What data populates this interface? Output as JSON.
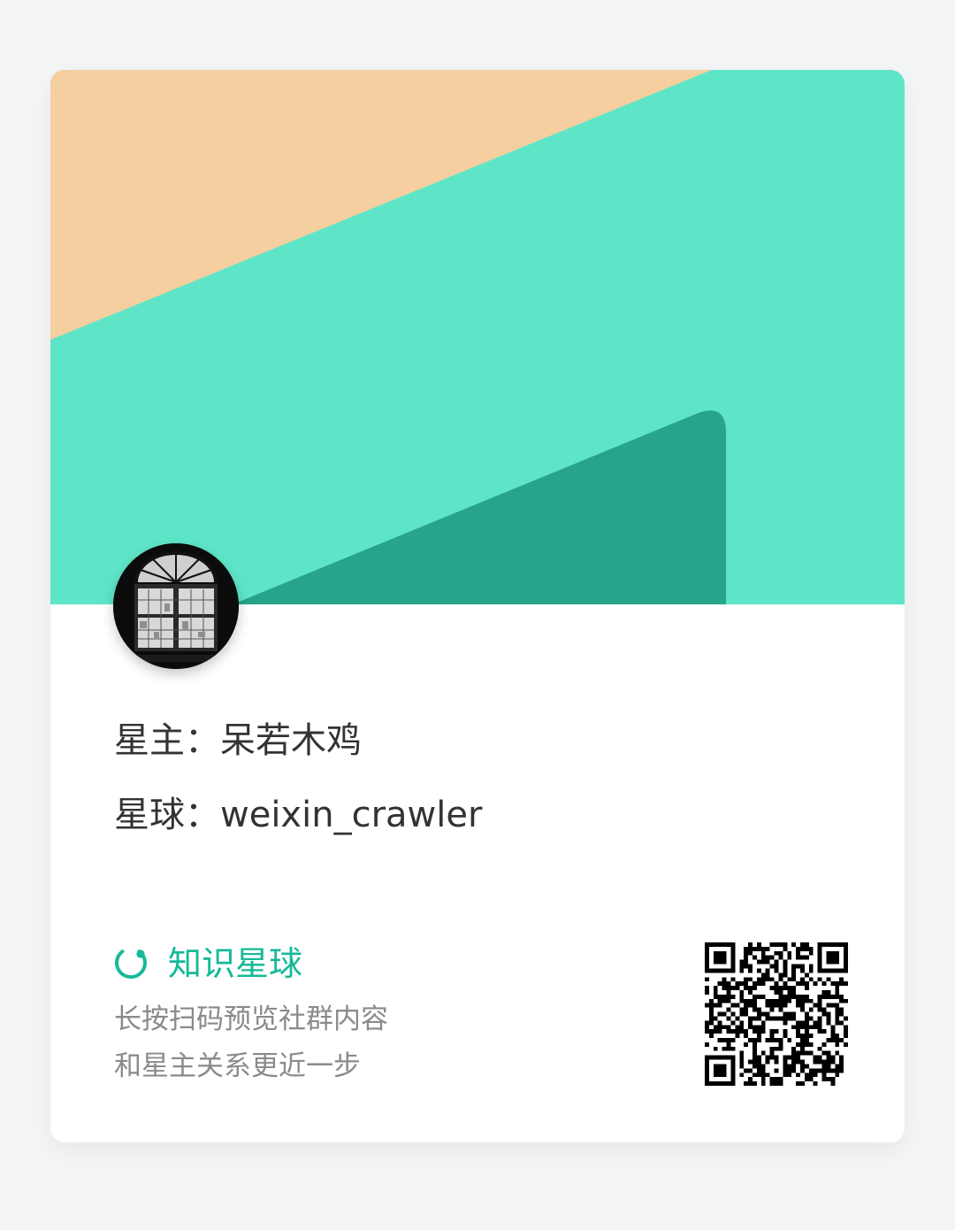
{
  "card": {
    "owner_text": "星主：呆若木鸡",
    "planet_text": "星球：weixin_crawler"
  },
  "banner": {
    "colors": {
      "peach": "#f5cf9f",
      "mint": "#5ee5c8",
      "teal": "#27a489"
    }
  },
  "avatar": {
    "icon": "arched-window-photo"
  },
  "footer": {
    "brand_name": "知识星球",
    "brand_icon": "refresh-circle-icon",
    "brand_color": "#16b998",
    "hint_line1": "长按扫码预览社群内容",
    "hint_line2": "和星主关系更近一步"
  },
  "qrcode": {
    "icon": "qr-code"
  }
}
